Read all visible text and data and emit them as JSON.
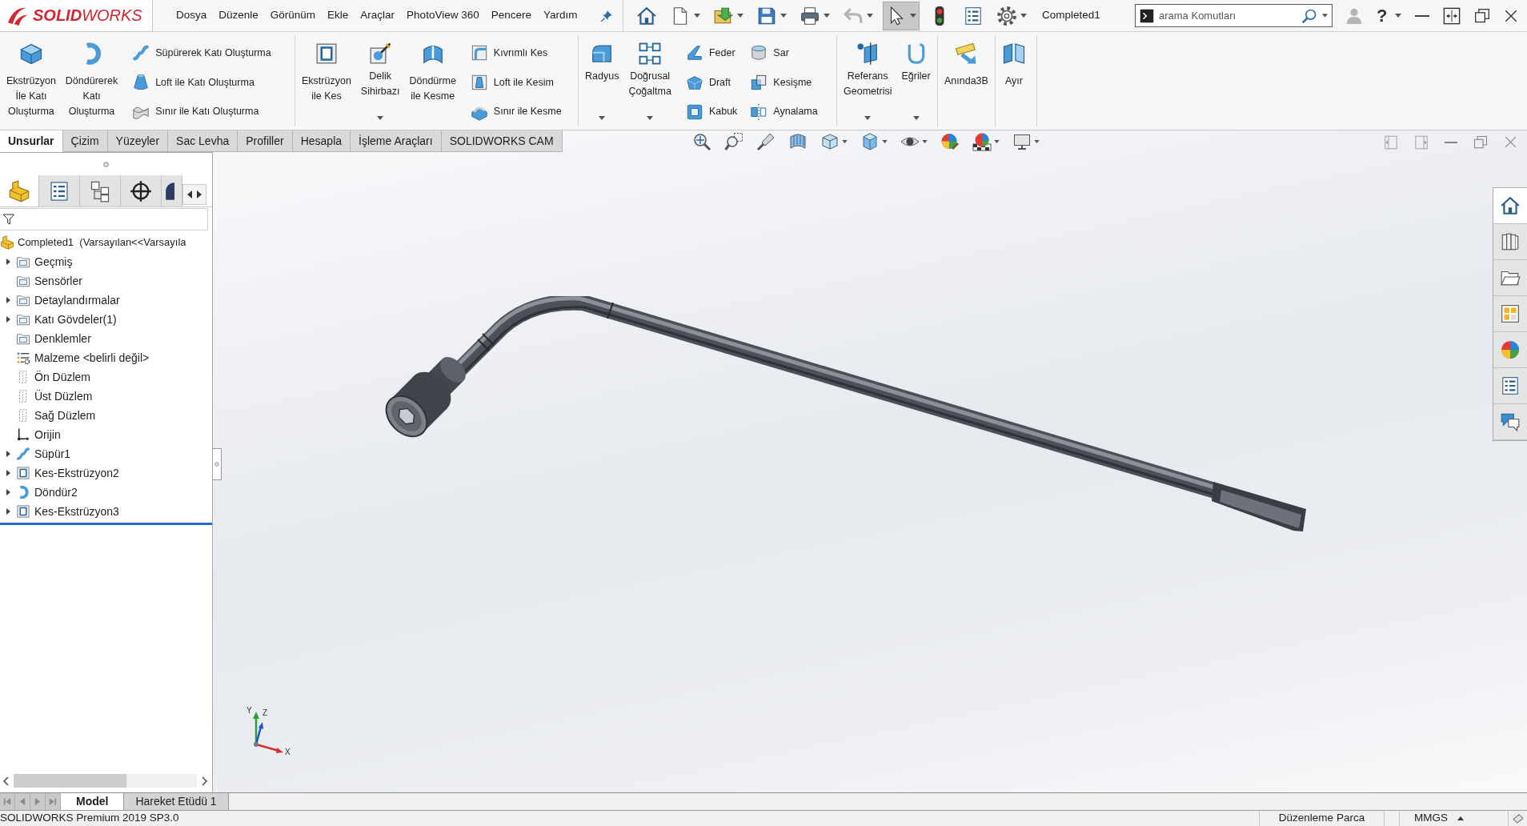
{
  "title_bar": {
    "logo": "**SOLID**WORKS",
    "menu": [
      "Dosya",
      "Düzenle",
      "Görünüm",
      "Ekle",
      "Araçlar",
      "PhotoView 360",
      "Pencere",
      "Yardım"
    ],
    "quick_access": [
      {
        "dropdown": false,
        "disabled": false,
        "pressed": false
      },
      {
        "dropdown": true,
        "disabled": false,
        "pressed": false
      },
      {
        "dropdown": true,
        "disabled": false,
        "pressed": false
      },
      {
        "dropdown": true,
        "disabled": false,
        "pressed": false
      },
      {
        "dropdown": true,
        "disabled": false,
        "pressed": false
      },
      {
        "dropdown": true,
        "disabled": true,
        "pressed": false
      },
      {
        "dropdown": true,
        "disabled": false,
        "pressed": true
      },
      {
        "dropdown": false,
        "disabled": false,
        "pressed": false
      },
      {
        "dropdown": false,
        "disabled": false,
        "pressed": false
      },
      {
        "dropdown": true,
        "disabled": false,
        "pressed": false
      }
    ],
    "document": "Completed1",
    "search": {
      "placeholder": "arama Komutları"
    },
    "help": "?"
  },
  "ribbon": [
    {
      "items": [
        {
          "kind": "large",
          "label": "Ekstrüzyon\nİle Katı\nOluşturma",
          "dropdown": false
        },
        {
          "kind": "large",
          "label": "Döndürerek\nKatı\nOluşturma",
          "dropdown": false
        },
        {
          "kind": "stack",
          "labels": [
            "Süpürerek Katı Oluşturma",
            "Loft ile Katı Oluşturma",
            "Sınır ile Katı Oluşturma"
          ]
        }
      ]
    },
    {
      "items": [
        {
          "kind": "large",
          "label": "Ekstrüzyon\nile Kes",
          "dropdown": false
        },
        {
          "kind": "large",
          "label": "Delik\nSihirbazı",
          "dropdown": true
        },
        {
          "kind": "large",
          "label": "Döndürme\nile Kesme",
          "dropdown": false
        },
        {
          "kind": "stack",
          "labels": [
            "Kıvrımlı Kes",
            "Loft ile Kesim",
            "Sınır ile Kesme"
          ]
        }
      ]
    },
    {
      "items": [
        {
          "kind": "large",
          "label": "Radyus",
          "dropdown": true
        },
        {
          "kind": "large",
          "label": "Doğrusal\nÇoğaltma",
          "dropdown": true
        },
        {
          "kind": "stack",
          "labels": [
            "Feder",
            "Draft",
            "Kabuk"
          ]
        },
        {
          "kind": "stack",
          "labels": [
            "Sar",
            "Kesişme",
            "Aynalama"
          ]
        }
      ]
    },
    {
      "items": [
        {
          "kind": "large",
          "label": "Referans\nGeometrisi",
          "dropdown": true
        },
        {
          "kind": "large",
          "label": "Eğriler",
          "dropdown": true
        }
      ]
    },
    {
      "items": [
        {
          "kind": "large",
          "label": "Anında3B",
          "dropdown": false
        }
      ]
    },
    {
      "items": [
        {
          "kind": "large",
          "label": "Ayır",
          "dropdown": false
        }
      ]
    }
  ],
  "command_tabs": [
    {
      "label": "Unsurlar",
      "selected": true
    },
    {
      "label": "Çizim",
      "selected": false
    },
    {
      "label": "Yüzeyler",
      "selected": false
    },
    {
      "label": "Sac Levha",
      "selected": false
    },
    {
      "label": "Profiller",
      "selected": false
    },
    {
      "label": "Hesapla",
      "selected": false
    },
    {
      "label": "İşleme Araçları",
      "selected": false
    },
    {
      "label": "SOLIDWORKS CAM",
      "selected": false
    }
  ],
  "view_toolbar": [
    {
      "dropdown": false
    },
    {
      "dropdown": false
    },
    {
      "dropdown": false
    },
    {
      "dropdown": false
    },
    {
      "dropdown": true
    },
    {
      "dropdown": true
    },
    {
      "dropdown": true
    },
    {
      "dropdown": false
    },
    {
      "dropdown": true
    },
    {
      "dropdown": true
    }
  ],
  "feature_tree": {
    "panel_tabs": [
      {
        "selected": true
      },
      {
        "selected": false
      },
      {
        "selected": false
      },
      {
        "selected": false
      },
      {
        "selected": false
      }
    ],
    "root": {
      "label": "Completed1  (Varsayılan<<Varsayıla",
      "children": [
        {
          "label": "Geçmiş",
          "kind": "folder",
          "expandable": true
        },
        {
          "label": "Sensörler",
          "kind": "folder",
          "expandable": false
        },
        {
          "label": "Detaylandırmalar",
          "kind": "folder",
          "expandable": true
        },
        {
          "label": "Katı Gövdeler(1)",
          "kind": "folder",
          "expandable": true
        },
        {
          "label": "Denklemler",
          "kind": "folder",
          "expandable": false
        },
        {
          "label": "Malzeme <belirli değil>",
          "kind": "material",
          "expandable": false
        },
        {
          "label": "Ön Düzlem",
          "kind": "plane",
          "expandable": false
        },
        {
          "label": "Üst Düzlem",
          "kind": "plane",
          "expandable": false
        },
        {
          "label": "Sağ Düzlem",
          "kind": "plane",
          "expandable": false
        },
        {
          "label": "Orijin",
          "kind": "origin",
          "expandable": false
        },
        {
          "label": "Süpür1",
          "kind": "sweep",
          "expandable": true
        },
        {
          "label": "Kes-Ekstrüzyon2",
          "kind": "cut",
          "expandable": true
        },
        {
          "label": "Döndür2",
          "kind": "revolve",
          "expandable": true
        },
        {
          "label": "Kes-Ekstrüzyon3",
          "kind": "cut",
          "expandable": true
        }
      ]
    }
  },
  "task_pane": [
    {
      "selected": true
    },
    {
      "selected": false
    },
    {
      "selected": false
    },
    {
      "selected": false
    },
    {
      "selected": false
    },
    {
      "selected": false
    },
    {
      "selected": false
    }
  ],
  "axis_triad": {
    "x": "X",
    "y": "Y",
    "z": "Z"
  },
  "bottom_tabs": [
    {
      "label": "Model",
      "selected": true
    },
    {
      "label": "Hareket Etüdü 1",
      "selected": false
    }
  ],
  "status_bar": {
    "product": "SOLIDWORKS Premium 2019 SP3.0",
    "mode": "Düzenleme Parca",
    "units": "MMGS"
  }
}
